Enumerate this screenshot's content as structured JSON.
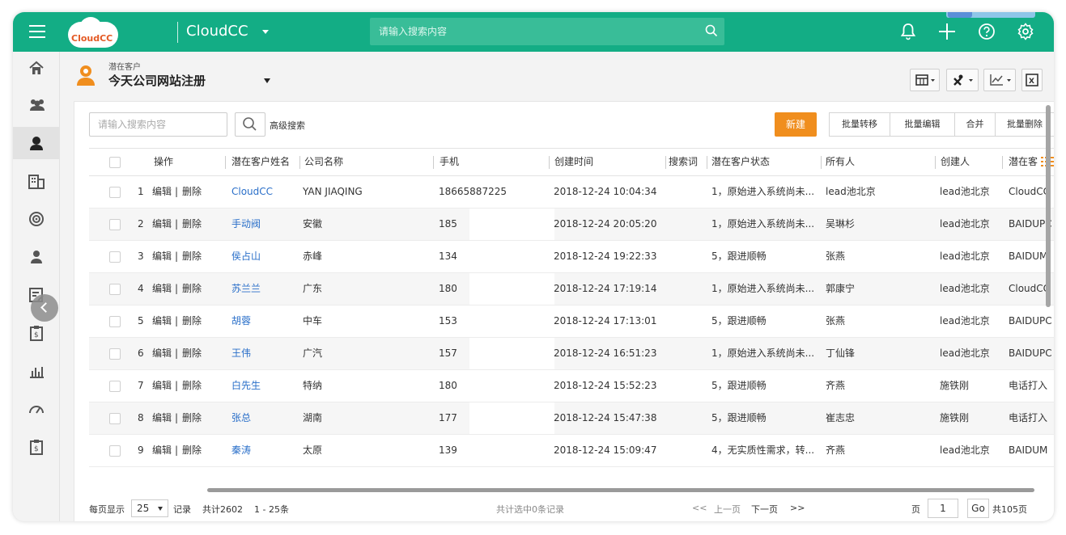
{
  "topbar": {
    "logo_text": "CloudCC",
    "app_name": "CloudCC",
    "search_placeholder": "请输入搜索内容",
    "icons": [
      "bell-icon",
      "plus-icon",
      "help-icon",
      "gear-icon"
    ]
  },
  "sidebar": {
    "items": [
      "home-icon",
      "group-icon",
      "lead-icon",
      "building-icon",
      "target-icon",
      "contact-icon",
      "report-icon",
      "doc-icon",
      "chart-icon",
      "dashboard-icon",
      "clipboard-icon"
    ],
    "active": "lead-icon"
  },
  "header": {
    "object_label": "潜在客户",
    "view_title": "今天公司网站注册"
  },
  "toolbar": {
    "search_placeholder": "请输入搜索内容",
    "advanced_search": "高级搜索",
    "new": "新建",
    "batch_transfer": "批量转移",
    "batch_edit": "批量编辑",
    "merge": "合并",
    "batch_delete": "批量删除"
  },
  "table": {
    "columns": [
      "操作",
      "潜在客户姓名",
      "公司名称",
      "手机",
      "创建时间",
      "搜索词",
      "潜在客户状态",
      "所有人",
      "创建人",
      "潜在客"
    ],
    "action_edit": "编辑",
    "action_sep": "|",
    "action_delete": "删除",
    "rows": [
      {
        "no": "1",
        "name": "CloudCC",
        "company": "YAN JIAQING",
        "phone": "18665887225",
        "created": "2018-12-24 10:04:34",
        "keyword": "",
        "status": "1，原始进入系统尚未...",
        "owner": "lead池北京",
        "creator": "lead池北京",
        "source": "CloudCC"
      },
      {
        "no": "2",
        "name": "手动阀",
        "company": "安徽",
        "phone": "185",
        "created": "2018-12-24 20:05:20",
        "keyword": "",
        "status": "1，原始进入系统尚未...",
        "owner": "吴琳杉",
        "creator": "lead池北京",
        "source": "BAIDUPC"
      },
      {
        "no": "3",
        "name": "侯占山",
        "company": "赤峰",
        "phone": "134",
        "created": "2018-12-24 19:22:33",
        "keyword": "",
        "status": "5，跟进顺畅",
        "owner": "张燕",
        "creator": "lead池北京",
        "source": "BAIDUM"
      },
      {
        "no": "4",
        "name": "苏兰兰",
        "company": "广东",
        "phone": "180",
        "created": "2018-12-24 17:19:14",
        "keyword": "",
        "status": "1，原始进入系统尚未...",
        "owner": "郭康宁",
        "creator": "lead池北京",
        "source": "CloudCC"
      },
      {
        "no": "5",
        "name": "胡蓉",
        "company": "中车",
        "phone": "153",
        "created": "2018-12-24 17:13:01",
        "keyword": "",
        "status": "5，跟进顺畅",
        "owner": "张燕",
        "creator": "lead池北京",
        "source": "BAIDUPC"
      },
      {
        "no": "6",
        "name": "王伟",
        "company": "广汽",
        "phone": "157",
        "created": "2018-12-24 16:51:23",
        "keyword": "",
        "status": "1，原始进入系统尚未...",
        "owner": "丁仙锋",
        "creator": "lead池北京",
        "source": "BAIDUPC"
      },
      {
        "no": "7",
        "name": "白先生",
        "company": "特纳",
        "phone": "180",
        "created": "2018-12-24 15:52:23",
        "keyword": "",
        "status": "5，跟进顺畅",
        "owner": "齐燕",
        "creator": "施铁刚",
        "source": "电话打入"
      },
      {
        "no": "8",
        "name": "张总",
        "company": "湖南",
        "phone": "177",
        "created": "2018-12-24 15:47:38",
        "keyword": "",
        "status": "5，跟进顺畅",
        "owner": "崔志忠",
        "creator": "施铁刚",
        "source": "电话打入"
      },
      {
        "no": "9",
        "name": "秦涛",
        "company": "太原",
        "phone": "139",
        "created": "2018-12-24 15:09:47",
        "keyword": "",
        "status": "4，无实质性需求，转...",
        "owner": "齐燕",
        "creator": "lead池北京",
        "source": "BAIDUM"
      }
    ]
  },
  "footer": {
    "per_page_label": "每页显示",
    "per_page_value": "25",
    "records_label": "记录",
    "total": "共计2602",
    "range": "1 - 25条",
    "selected": "共计选中0条记录",
    "first": "<<",
    "prev": "上一页",
    "next": "下一页",
    "last": ">>",
    "page_label": "页",
    "page_value": "1",
    "go": "Go",
    "total_pages": "共105页"
  },
  "colors": {
    "topbar": "#13ad85",
    "new_button": "#f08e1e",
    "link": "#2a6fc9",
    "lead_icon": "#f08e1e"
  }
}
